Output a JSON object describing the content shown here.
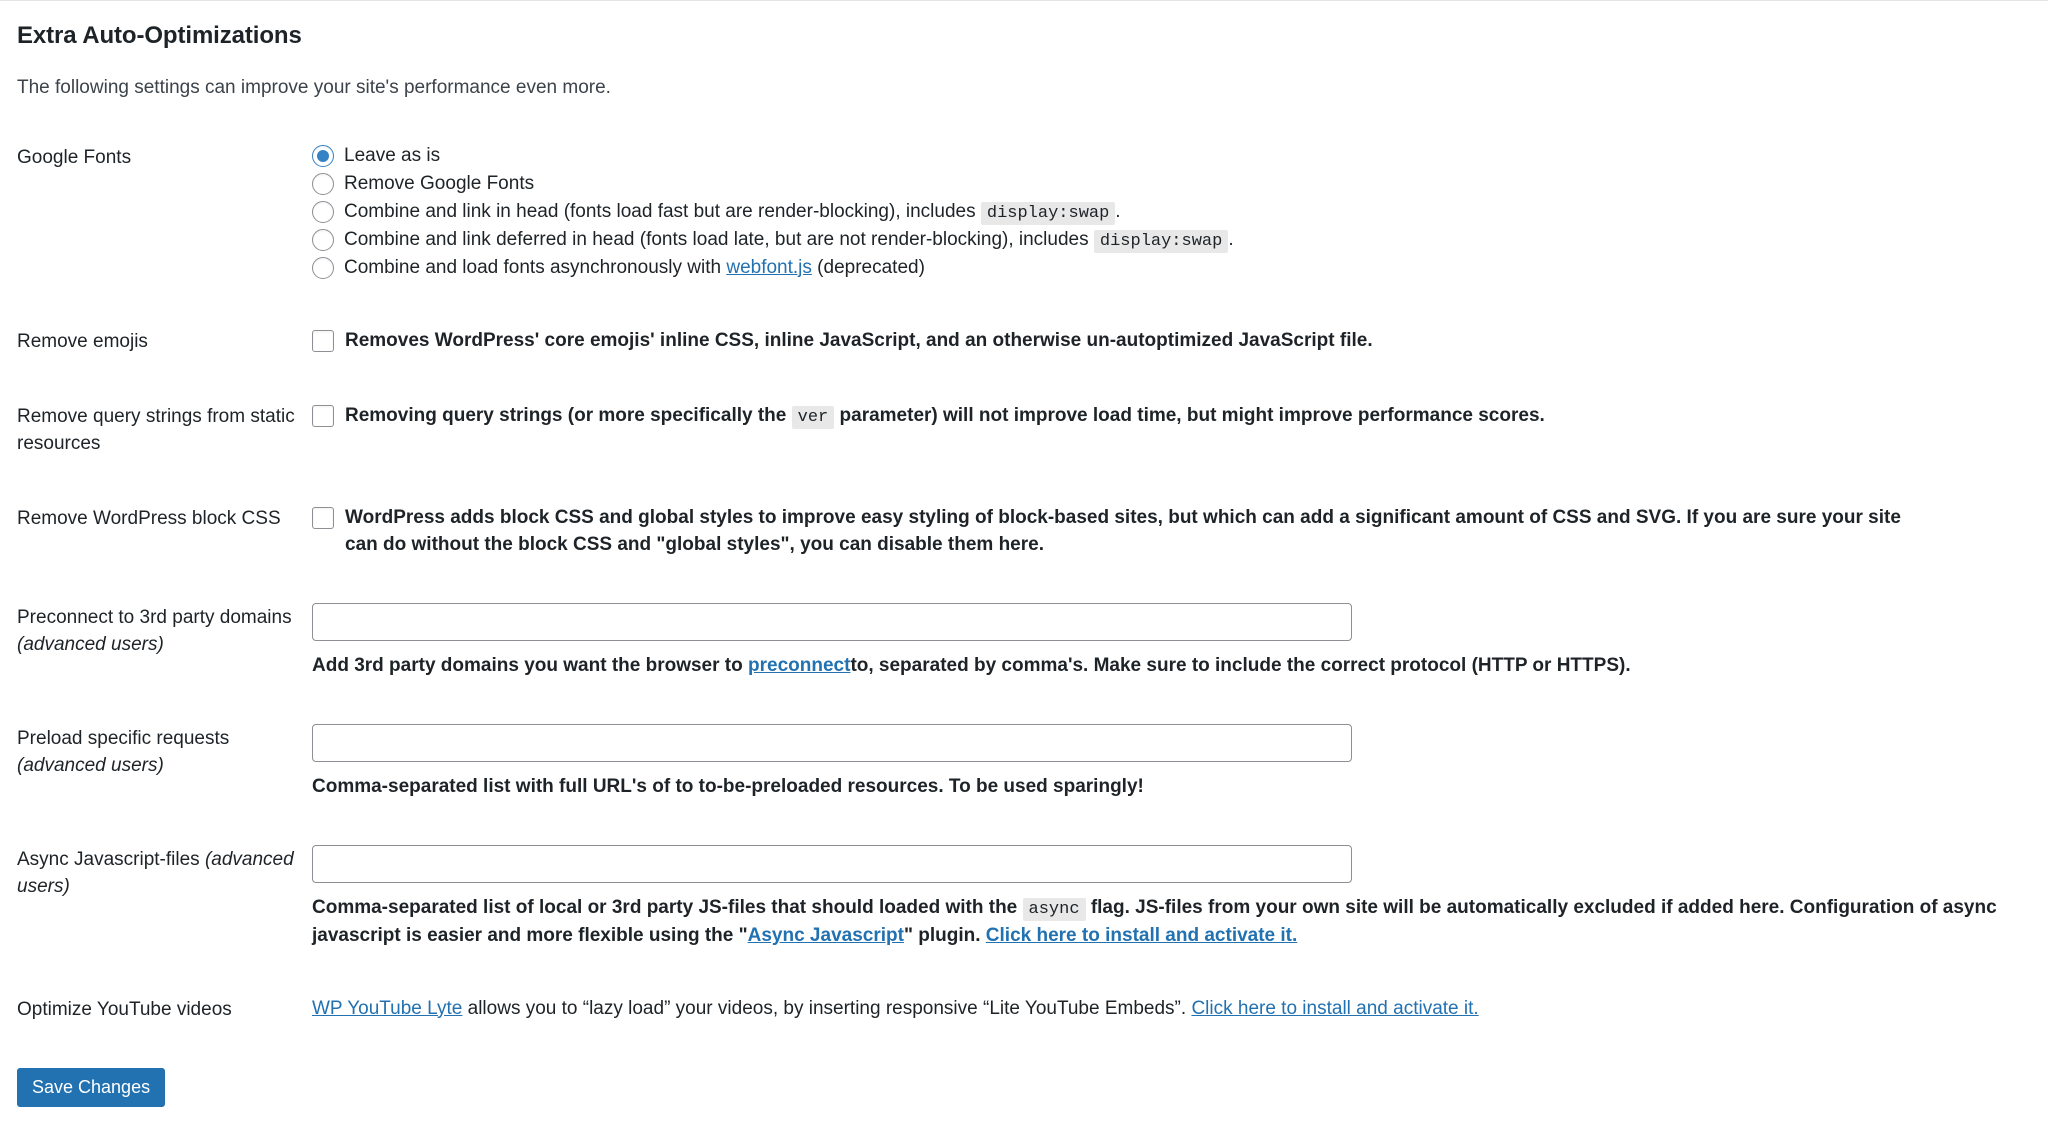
{
  "section": {
    "title": "Extra Auto-Optimizations",
    "description": "The following settings can improve your site's performance even more."
  },
  "rows": {
    "google_fonts": {
      "label": "Google Fonts",
      "options": [
        {
          "label": "Leave as is",
          "selected": true
        },
        {
          "label": "Remove Google Fonts",
          "selected": false
        },
        {
          "pre": "Combine and link in head (fonts load fast but are render-blocking), includes",
          "code": "display:swap",
          "post": ".",
          "selected": false
        },
        {
          "pre": "Combine and link deferred in head (fonts load late, but are not render-blocking), includes",
          "code": "display:swap",
          "post": ".",
          "selected": false
        },
        {
          "pre": "Combine and load fonts asynchronously with",
          "link": "webfont.js",
          "post": "(deprecated)",
          "selected": false
        }
      ]
    },
    "remove_emojis": {
      "label": "Remove emojis",
      "checkbox_label": "Removes WordPress' core emojis' inline CSS, inline JavaScript, and an otherwise un-autoptimized JavaScript file.",
      "checked": false
    },
    "remove_query_strings": {
      "label": "Remove query strings from static resources",
      "checkbox_pre": "Removing query strings (or more specifically the",
      "checkbox_code": "ver",
      "checkbox_post": "parameter) will not improve load time, but might improve performance scores.",
      "checked": false
    },
    "remove_block_css": {
      "label": "Remove WordPress block CSS",
      "checkbox_label": "WordPress adds block CSS and global styles to improve easy styling of block-based sites, but which can add a significant amount of CSS and SVG. If you are sure your site can do without the block CSS and \"global styles\", you can disable them here.",
      "checked": false
    },
    "preconnect": {
      "label": "Preconnect to 3rd party domains",
      "label_em": "(advanced users)",
      "value": "",
      "desc_pre": "Add 3rd party domains you want the browser to",
      "desc_link": "preconnect",
      "desc_post": "to, separated by comma's. Make sure to include the correct protocol (HTTP or HTTPS)."
    },
    "preload": {
      "label": "Preload specific requests",
      "label_em": "(advanced users)",
      "value": "",
      "desc": "Comma-separated list with full URL's of to to-be-preloaded resources. To be used sparingly!"
    },
    "async_js": {
      "label": "Async Javascript-files",
      "label_em": "(advanced users)",
      "value": "",
      "desc_pre": "Comma-separated list of local or 3rd party JS-files that should loaded with the",
      "desc_code": "async",
      "desc_mid": "flag. JS-files from your own site will be automatically excluded if added here. Configuration of async javascript is easier and more flexible using the \"",
      "desc_link1": "Async Javascript",
      "desc_mid2": "\" plugin.",
      "desc_link2": "Click here to install and activate it."
    },
    "youtube": {
      "label": "Optimize YouTube videos",
      "link1": "WP YouTube Lyte",
      "text_mid": "allows you to “lazy load” your videos, by inserting responsive “Lite YouTube Embeds”.",
      "link2": "Click here to install and activate it."
    }
  },
  "submit": {
    "save_label": "Save Changes"
  },
  "colors": {
    "accent": "#2271b1",
    "radio_checked": "#3582c4",
    "link": "#2271b1",
    "code_bg": "#e8e8e8"
  }
}
